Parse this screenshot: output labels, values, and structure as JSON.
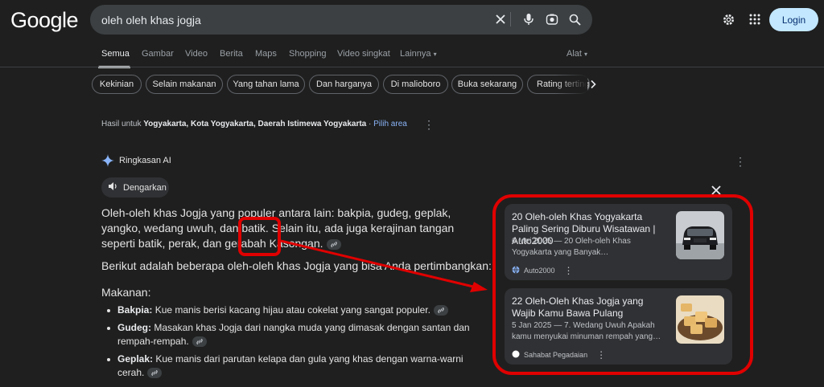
{
  "header": {
    "logo": "Google",
    "search_value": "oleh oleh khas jogja",
    "login_label": "Login"
  },
  "tabs": [
    {
      "label": "Semua"
    },
    {
      "label": "Gambar"
    },
    {
      "label": "Video"
    },
    {
      "label": "Berita"
    },
    {
      "label": "Maps"
    },
    {
      "label": "Shopping"
    },
    {
      "label": "Video singkat"
    },
    {
      "label": "Lainnya"
    },
    {
      "label": "Alat"
    }
  ],
  "chips": [
    "Kekinian",
    "Selain makanan",
    "Yang tahan lama",
    "Dan harganya",
    "Di malioboro",
    "Buka sekarang",
    "Rating tertinggi"
  ],
  "location": {
    "prefix": "Hasil untuk",
    "place": "Yogyakarta, Kota Yogyakarta, Daerah Istimewa Yogyakarta",
    "sep": " · ",
    "link": "Pilih area"
  },
  "ai": {
    "title": "Ringkasan AI",
    "listen_label": "Dengarkan",
    "paragraph1": "Oleh-oleh khas Jogja yang populer antara lain: bakpia, gudeg, geplak, yangko, wedang uwuh, dan batik. Selain itu, ada juga kerajinan tangan seperti batik, perak, dan gerabah Kasongan.",
    "paragraph2": "Berikut adalah beberapa oleh-oleh khas Jogja yang bisa Anda pertimbangkan:",
    "section_heading": "Makanan:",
    "items": [
      {
        "name": "Bakpia:",
        "desc": " Kue manis berisi kacang hijau atau cokelat yang sangat populer."
      },
      {
        "name": "Gudeg:",
        "desc": " Masakan khas Jogja dari nangka muda yang dimasak dengan santan dan rempah-rempah."
      },
      {
        "name": "Geplak:",
        "desc": " Kue manis dari parutan kelapa dan gula yang khas dengan warna-warni cerah."
      }
    ]
  },
  "sources": [
    {
      "title": "20 Oleh-oleh Khas Yogyakarta Paling Sering Diburu Wisatawan | Auto2000",
      "snippet": "6 Mei 2025 — 20 Oleh-oleh Khas Yogyakarta yang Banyak…",
      "site": "Auto2000",
      "thumb": "car-photo"
    },
    {
      "title": "22 Oleh-Oleh Khas Jogja yang Wajib Kamu Bawa Pulang",
      "snippet": "5 Jan 2025 — 7. Wedang Uwuh Apakah kamu menyukai minuman rempah yang…",
      "site": "Sahabat Pegadaian",
      "thumb": "bakpia-photo"
    }
  ],
  "colors": {
    "background": "#1f1f1f",
    "accent_link": "#8ab4f8",
    "annotation_red": "#e00000",
    "login_bg": "#c2e7ff"
  }
}
